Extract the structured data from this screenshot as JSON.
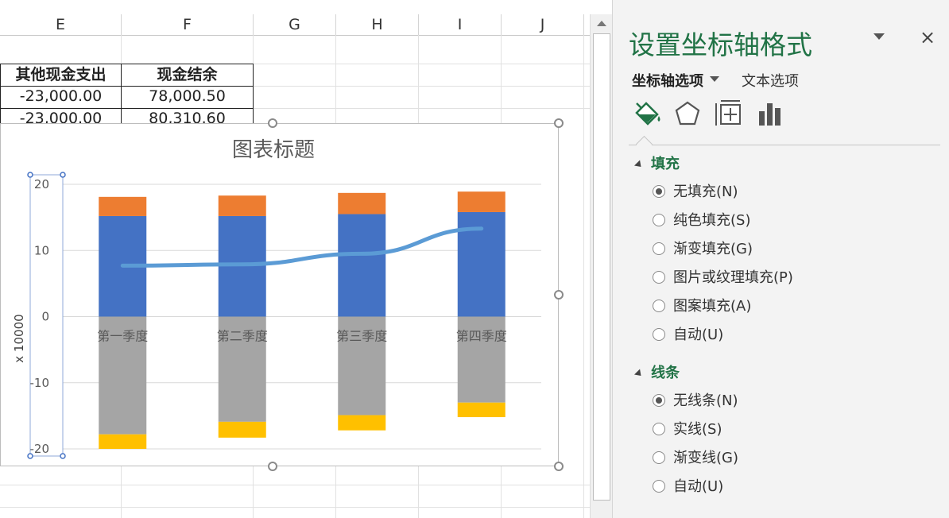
{
  "sheet": {
    "columns": [
      "E",
      "F",
      "G",
      "H",
      "I",
      "J"
    ],
    "table": {
      "headers": [
        "其他现金支出",
        "现金结余"
      ],
      "rows": [
        [
          "-23,000.00",
          "78,000.50"
        ],
        [
          "-23,000.00",
          "80,310.60"
        ]
      ]
    }
  },
  "chart_data": {
    "type": "bar",
    "title": "图表标题",
    "ylabel": "x 10000",
    "ylim": [
      -20,
      20
    ],
    "yticks": [
      "20",
      "10",
      "0",
      "-10",
      "-20"
    ],
    "categories": [
      "第一季度",
      "第二季度",
      "第三季度",
      "第四季度"
    ],
    "stacked_series": [
      {
        "color": "#4472C4",
        "values": [
          15.2,
          15.2,
          15.5,
          15.8
        ]
      },
      {
        "color": "#ED7D31",
        "values": [
          2.9,
          3.1,
          3.2,
          3.1
        ]
      },
      {
        "color": "#A5A5A5",
        "values": [
          -17.8,
          -15.9,
          -14.9,
          -13.0
        ]
      },
      {
        "color": "#FFC000",
        "values": [
          -2.2,
          -2.4,
          -2.3,
          -2.2
        ]
      }
    ],
    "line_series": {
      "color": "#5B9BD5",
      "values": [
        7.7,
        7.9,
        9.5,
        13.3
      ]
    }
  },
  "pane": {
    "title": "设置坐标轴格式",
    "close_icon": "×",
    "tabs": {
      "axis": "坐标轴选项",
      "text": "文本选项"
    },
    "icons": [
      "fill-line-icon",
      "effects-icon",
      "size-properties-icon",
      "axis-options-icon"
    ],
    "fill": {
      "title": "填充",
      "options": [
        "无填充(N)",
        "纯色填充(S)",
        "渐变填充(G)",
        "图片或纹理填充(P)",
        "图案填充(A)",
        "自动(U)"
      ],
      "selected": 0
    },
    "line": {
      "title": "线条",
      "options": [
        "无线条(N)",
        "实线(S)",
        "渐变线(G)",
        "自动(U)"
      ],
      "selected": 0
    }
  },
  "colors": {
    "accent": "#217346"
  }
}
